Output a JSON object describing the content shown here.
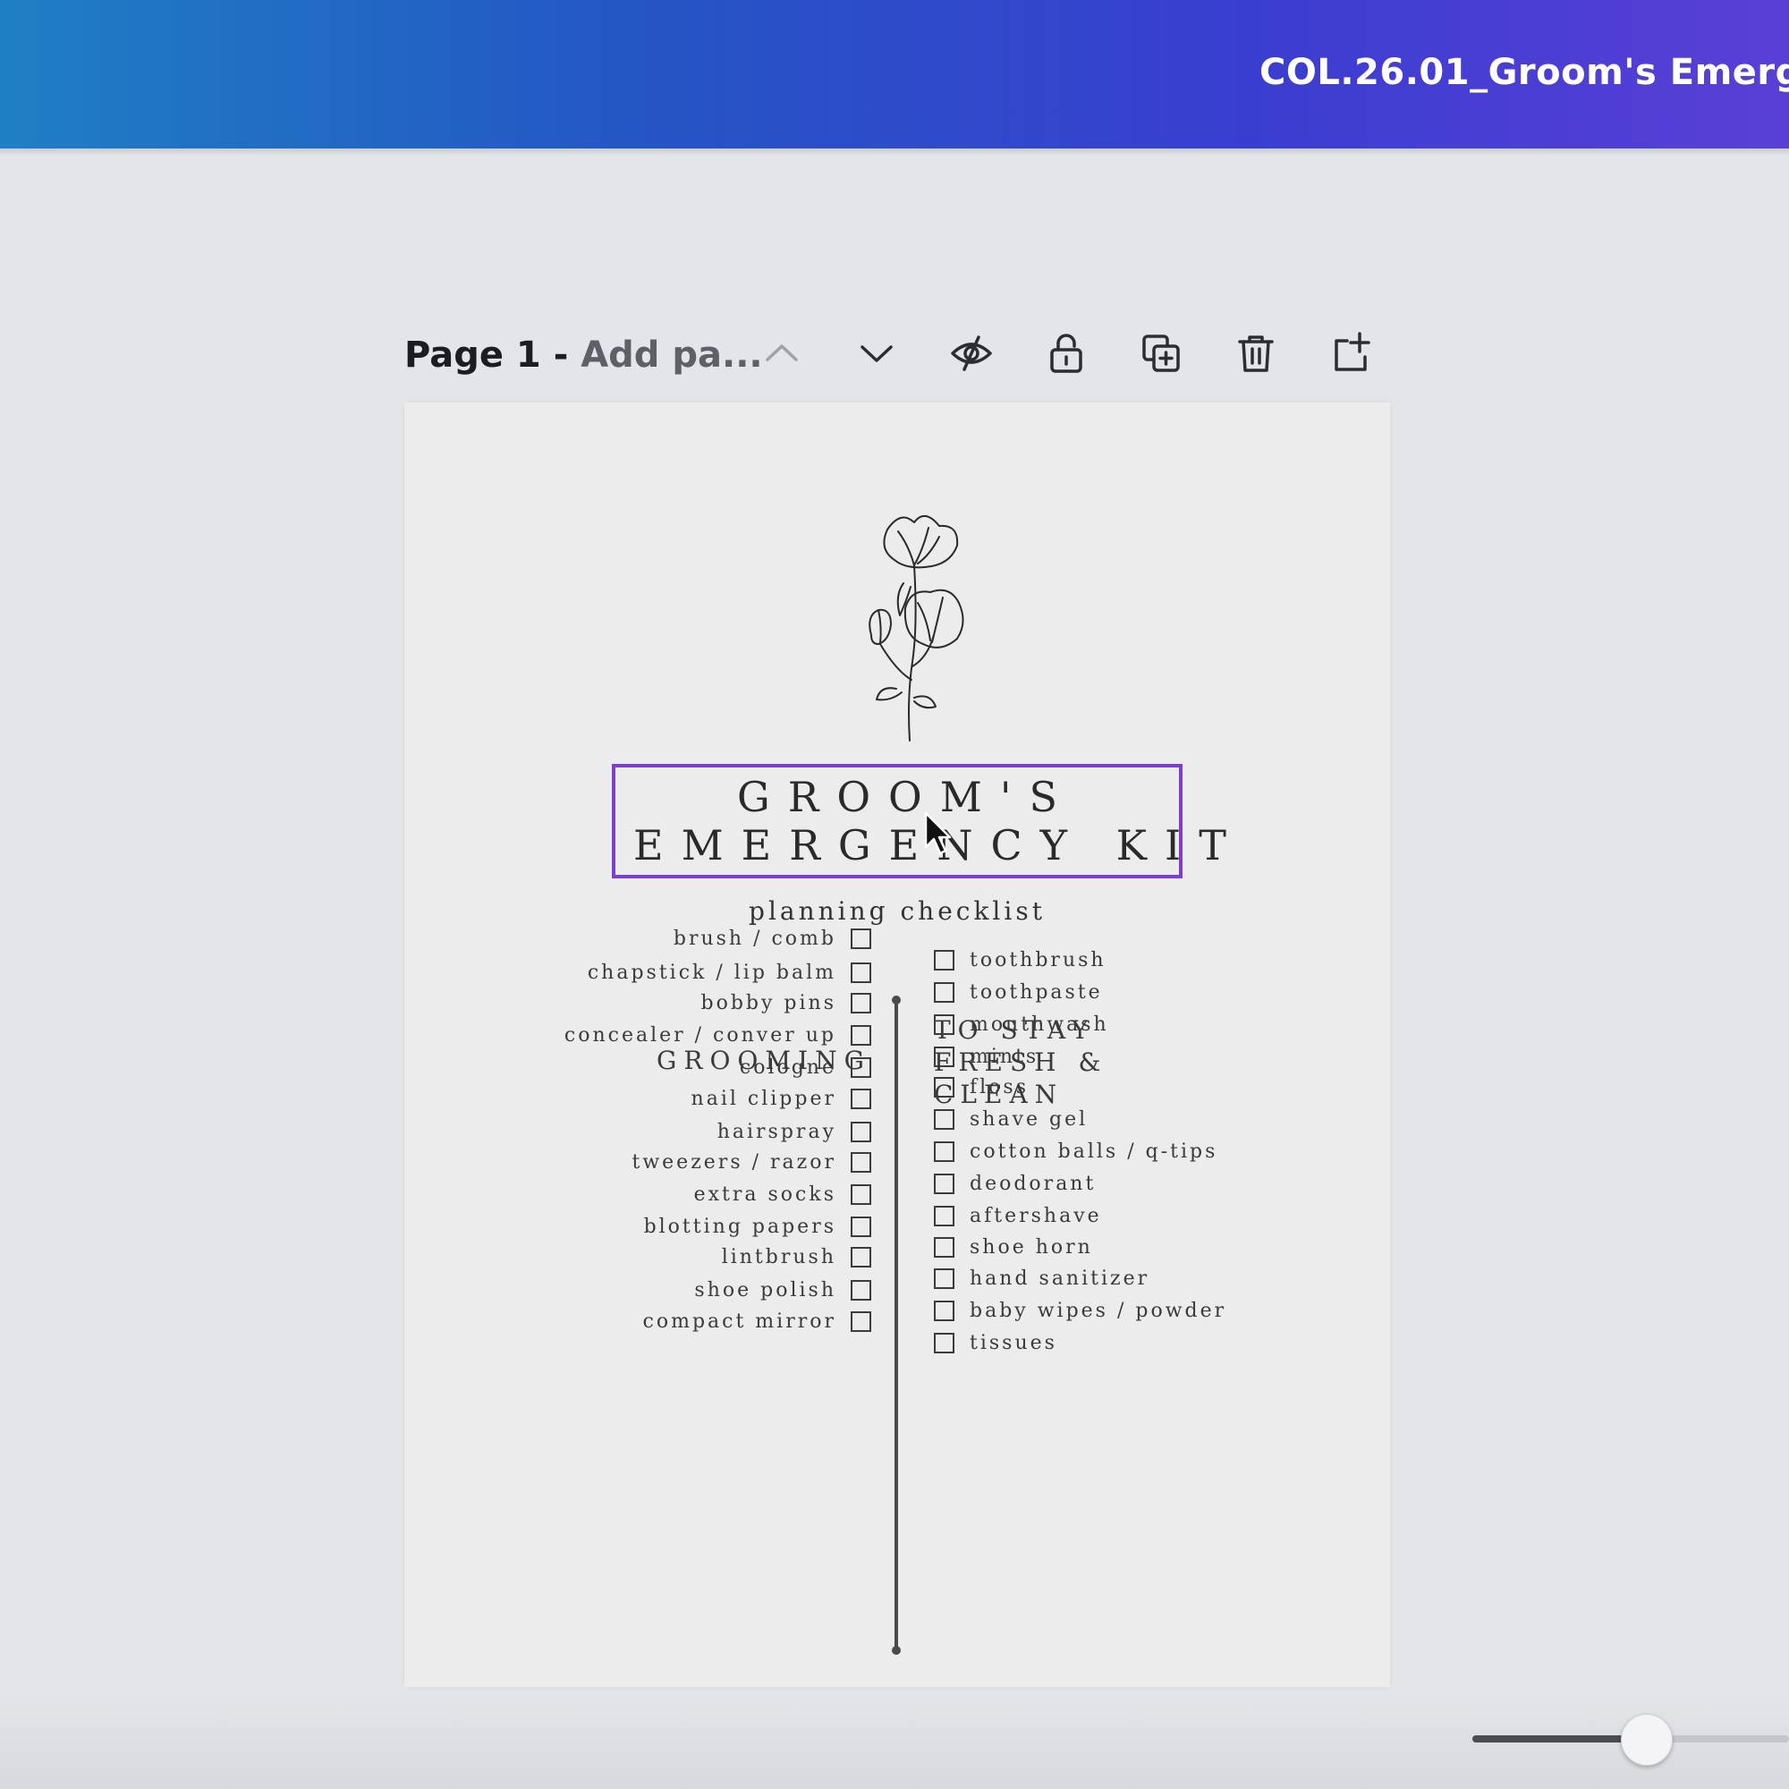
{
  "header": {
    "doc_title": "COL.26.01_Groom's Emergenc",
    "gradient_colors": [
      "#1f7fc4",
      "#2456c4",
      "#3a3ed0",
      "#5a3fd6"
    ]
  },
  "page_toolbar": {
    "page_number": "Page 1",
    "separator": " - ",
    "page_title_placeholder": "Add pa...",
    "icons": [
      "chevron-up-icon",
      "chevron-down-icon",
      "hide-eye-icon",
      "lock-icon",
      "duplicate-page-icon",
      "trash-icon",
      "add-page-icon"
    ]
  },
  "design": {
    "title_line1": "GROOM'S",
    "title_line2": "EMERGENCY KIT",
    "subtitle": "planning checklist",
    "selection_color": "#7d3fcf",
    "grooming": {
      "heading": "GROOMING",
      "items": [
        "brush / comb",
        "chapstick / lip balm",
        "bobby pins",
        "concealer / conver up",
        "cologne",
        "nail clipper",
        "hairspray",
        "tweezers / razor",
        "extra socks",
        "blotting papers",
        "lintbrush",
        "shoe polish",
        "compact mirror"
      ]
    },
    "fresh": {
      "heading_lines": [
        "TO STAY",
        "FRESH &",
        "CLEAN"
      ],
      "items": [
        "toothbrush",
        "toothpaste",
        "mouthwash",
        "mints",
        "floss",
        "shave gel",
        "cotton balls / q-tips",
        "deodorant",
        "aftershave",
        "shoe horn",
        "hand sanitizer",
        "baby wipes / powder",
        "tissues"
      ]
    }
  },
  "zoom": {
    "slider_fraction": 0.55
  }
}
